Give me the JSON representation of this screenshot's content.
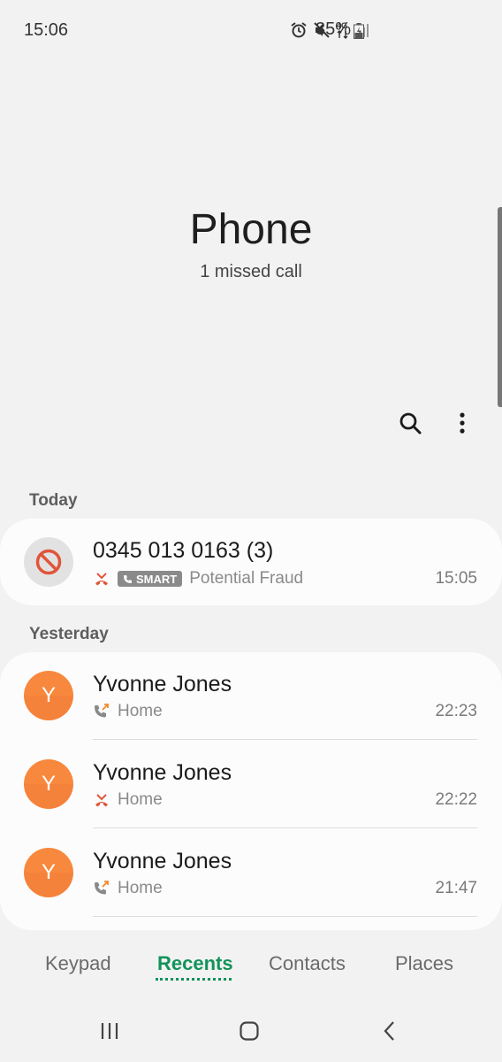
{
  "status_bar": {
    "time": "15:06",
    "battery_percent": "35%",
    "icons": [
      "alarm-icon",
      "mute-icon",
      "4g-icon",
      "signal-icon",
      "battery-icon"
    ]
  },
  "header": {
    "title": "Phone",
    "subtitle": "1 missed call"
  },
  "actions": {
    "search_icon": "search-icon",
    "more_icon": "more-vert-icon"
  },
  "sections": {
    "today": "Today",
    "yesterday": "Yesterday"
  },
  "today_calls": [
    {
      "name": "0345 013 0163 (3)",
      "call_type": "missed",
      "tag": "SMART",
      "label": "Potential Fraud",
      "time": "15:05",
      "avatar": "blocked-icon"
    }
  ],
  "yesterday_calls": [
    {
      "name": "Yvonne Jones",
      "avatar_letter": "Y",
      "call_type": "outgoing",
      "label": "Home",
      "time": "22:23"
    },
    {
      "name": "Yvonne Jones",
      "avatar_letter": "Y",
      "call_type": "missed",
      "label": "Home",
      "time": "22:22"
    },
    {
      "name": "Yvonne Jones",
      "avatar_letter": "Y",
      "call_type": "outgoing",
      "label": "Home",
      "time": "21:47"
    }
  ],
  "tabs": [
    {
      "label": "Keypad",
      "active": false
    },
    {
      "label": "Recents",
      "active": true
    },
    {
      "label": "Contacts",
      "active": false
    },
    {
      "label": "Places",
      "active": false
    }
  ],
  "colors": {
    "accent": "#12935a",
    "avatar": "#f7883d",
    "missed": "#e0553a",
    "background": "#f2f2f2"
  }
}
